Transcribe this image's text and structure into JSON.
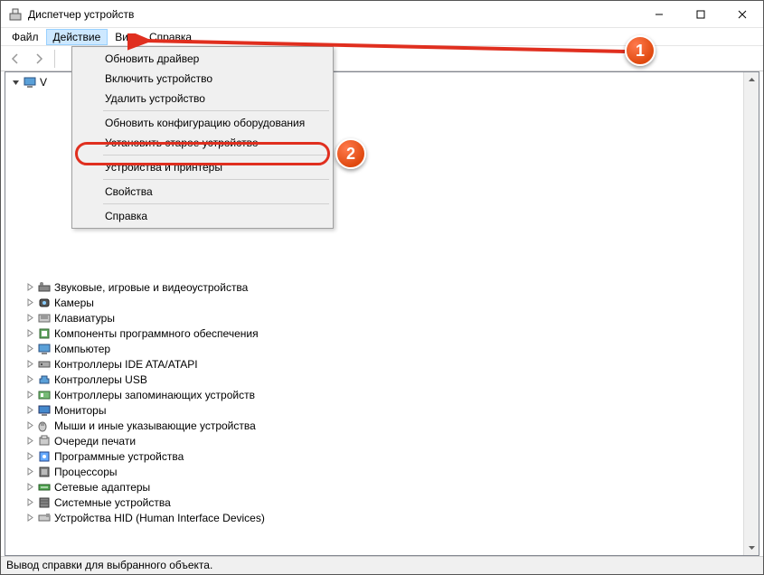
{
  "window": {
    "title": "Диспетчер устройств"
  },
  "menubar": {
    "file": "Файл",
    "action": "Действие",
    "view": "Вид",
    "help": "Справка"
  },
  "dropdown": {
    "update_driver": "Обновить драйвер",
    "enable_device": "Включить устройство",
    "remove_device": "Удалить устройство",
    "scan_hardware": "Обновить конфигурацию оборудования",
    "add_legacy": "Установить старое устройство",
    "devices_printers": "Устройства и принтеры",
    "properties": "Свойства",
    "help": "Справка"
  },
  "tree": {
    "root": "V",
    "items": [
      "Звуковые, игровые и видеоустройства",
      "Камеры",
      "Клавиатуры",
      "Компоненты программного обеспечения",
      "Компьютер",
      "Контроллеры IDE ATA/ATAPI",
      "Контроллеры USB",
      "Контроллеры запоминающих устройств",
      "Мониторы",
      "Мыши и иные указывающие устройства",
      "Очереди печати",
      "Программные устройства",
      "Процессоры",
      "Сетевые адаптеры",
      "Системные устройства",
      "Устройства HID (Human Interface Devices)"
    ]
  },
  "statusbar": {
    "text": "Вывод справки для выбранного объекта."
  },
  "annotations": {
    "callout1": "1",
    "callout2": "2"
  }
}
